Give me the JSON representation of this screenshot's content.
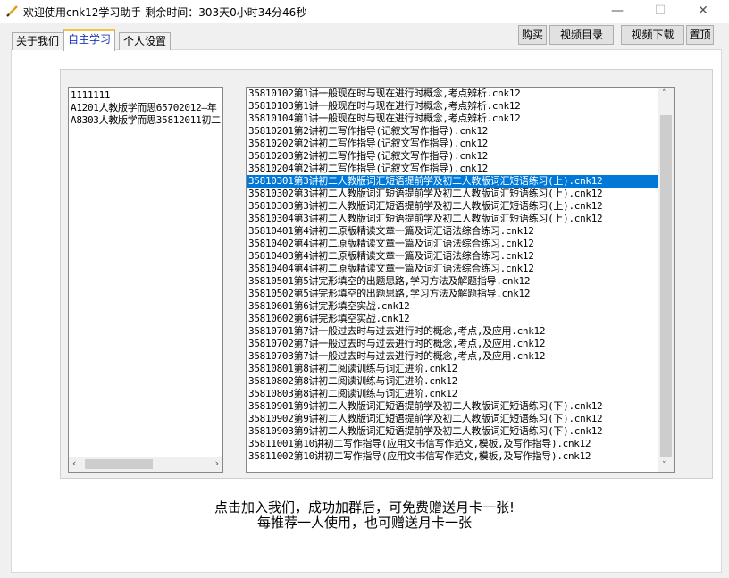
{
  "window": {
    "title": "欢迎使用cnk12学习助手 剩余时间：303天0小时34分46秒",
    "minimize": "—",
    "maximize": "☐",
    "close": "✕"
  },
  "tabs": [
    {
      "label": "关于我们"
    },
    {
      "label": "自主学习",
      "selected": true
    },
    {
      "label": "个人设置"
    }
  ],
  "toolbar": {
    "buy": "购买",
    "catalog": "视频目录",
    "download": "视频下载",
    "pin": "置顶"
  },
  "left_list": [
    "1111111",
    "A1201人教版学而思65702012—年",
    "A8303人教版学而思35812011初二"
  ],
  "right_list": {
    "selected_index": 7,
    "items": [
      "35810102第1讲一般现在时与现在进行时概念,考点辨析.cnk12",
      "35810103第1讲一般现在时与现在进行时概念,考点辨析.cnk12",
      "35810104第1讲一般现在时与现在进行时概念,考点辨析.cnk12",
      "35810201第2讲初二写作指导(记叙文写作指导).cnk12",
      "35810202第2讲初二写作指导(记叙文写作指导).cnk12",
      "35810203第2讲初二写作指导(记叙文写作指导).cnk12",
      "35810204第2讲初二写作指导(记叙文写作指导).cnk12",
      "35810301第3讲初二人教版词汇短语提前学及初二人教版词汇短语练习(上).cnk12",
      "35810302第3讲初二人教版词汇短语提前学及初二人教版词汇短语练习(上).cnk12",
      "35810303第3讲初二人教版词汇短语提前学及初二人教版词汇短语练习(上).cnk12",
      "35810304第3讲初二人教版词汇短语提前学及初二人教版词汇短语练习(上).cnk12",
      "35810401第4讲初二原版精读文章一篇及词汇语法综合练习.cnk12",
      "35810402第4讲初二原版精读文章一篇及词汇语法综合练习.cnk12",
      "35810403第4讲初二原版精读文章一篇及词汇语法综合练习.cnk12",
      "35810404第4讲初二原版精读文章一篇及词汇语法综合练习.cnk12",
      "35810501第5讲完形填空的出题思路,学习方法及解题指导.cnk12",
      "35810502第5讲完形填空的出题思路,学习方法及解题指导.cnk12",
      "35810601第6讲完形填空实战.cnk12",
      "35810602第6讲完形填空实战.cnk12",
      "35810701第7讲一般过去时与过去进行时的概念,考点,及应用.cnk12",
      "35810702第7讲一般过去时与过去进行时的概念,考点,及应用.cnk12",
      "35810703第7讲一般过去时与过去进行时的概念,考点,及应用.cnk12",
      "35810801第8讲初二阅读训练与词汇进阶.cnk12",
      "35810802第8讲初二阅读训练与词汇进阶.cnk12",
      "35810803第8讲初二阅读训练与词汇进阶.cnk12",
      "35810901第9讲初二人教版词汇短语提前学及初二人教版词汇短语练习(下).cnk12",
      "35810902第9讲初二人教版词汇短语提前学及初二人教版词汇短语练习(下).cnk12",
      "35810903第9讲初二人教版词汇短语提前学及初二人教版词汇短语练习(下).cnk12",
      "35811001第10讲初二写作指导(应用文书信写作范文,模板,及写作指导).cnk12",
      "35811002第10讲初二写作指导(应用文书信写作范文,模板,及写作指导).cnk12"
    ]
  },
  "promo": {
    "line1": "点击加入我们，成功加群后，可免费赠送月卡一张!",
    "line2": "每推荐一人使用，也可赠送月卡一张"
  }
}
